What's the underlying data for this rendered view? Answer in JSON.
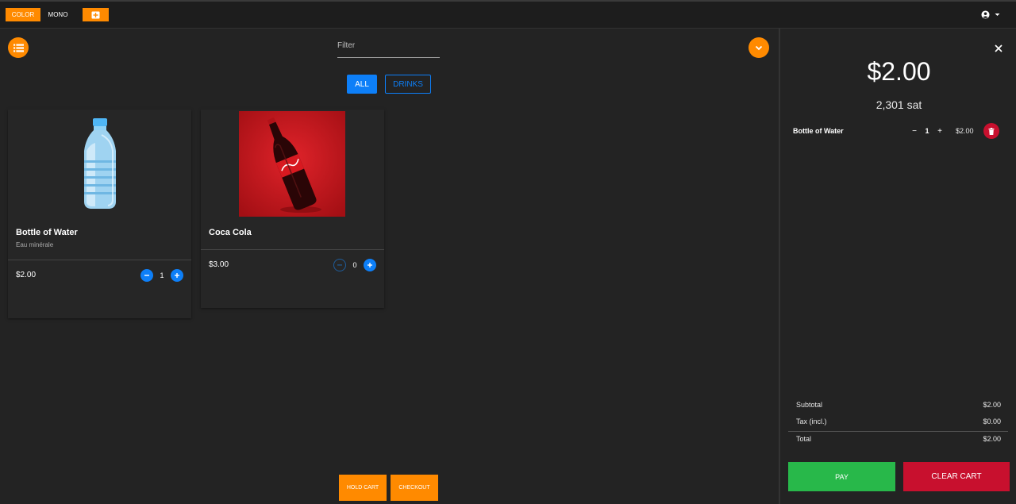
{
  "topbar": {
    "color_label": "COLOR",
    "mono_label": "MONO",
    "add_icon": "add-box-icon",
    "account_icon": "account-circle-icon",
    "account_caret_icon": "caret-down-icon"
  },
  "main": {
    "list_icon": "list-icon",
    "collapse_icon": "chevron-down-icon",
    "filter_placeholder": "Filter",
    "filter_value": "",
    "categories": [
      {
        "label": "ALL",
        "active": true
      },
      {
        "label": "DRINKS",
        "active": false
      }
    ],
    "products": [
      {
        "title": "Bottle of Water",
        "subtitle": "Eau minérale",
        "price": "$2.00",
        "quantity": "1",
        "image": "water-bottle-image"
      },
      {
        "title": "Coca Cola",
        "subtitle": "",
        "price": "$3.00",
        "quantity": "0",
        "image": "coca-cola-bottle-image"
      }
    ],
    "hold_cart_label": "HOLD CART",
    "checkout_label": "CHECKOUT"
  },
  "cart": {
    "close_icon": "close-icon",
    "total": "$2.00",
    "sats": "2,301 sat",
    "items": [
      {
        "name": "Bottle of Water",
        "quantity": "1",
        "price": "$2.00",
        "minus": "−",
        "plus": "+"
      }
    ],
    "summary": {
      "subtotal_label": "Subtotal",
      "subtotal_value": "$2.00",
      "tax_label": "Tax (incl.)",
      "tax_value": "$0.00",
      "total_label": "Total",
      "total_value": "$2.00"
    },
    "pay_label": "PAY",
    "clear_label": "CLEAR CART"
  },
  "colors": {
    "accent": "#ff8a00",
    "primary": "#0d7ff8",
    "success": "#28b84a",
    "danger": "#c8102e",
    "background": "#232323"
  }
}
